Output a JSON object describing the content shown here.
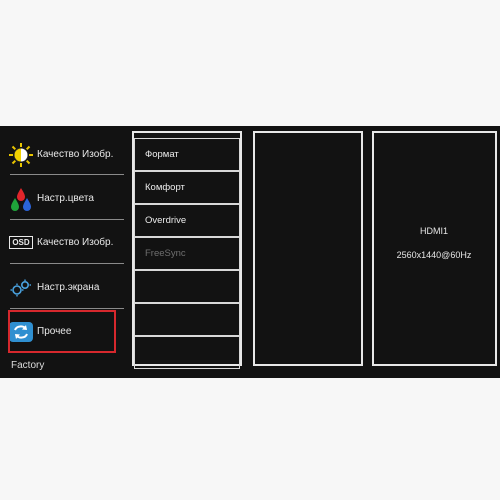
{
  "sidebar": {
    "items": [
      {
        "label": "Качество Изобр.",
        "icon": "brightness-icon"
      },
      {
        "label": "Настр.цвета",
        "icon": "color-drops-icon"
      },
      {
        "label": "Качество Изобр.",
        "icon": "osd-icon"
      },
      {
        "label": "Настр.экрана",
        "icon": "screen-settings-icon"
      },
      {
        "label": "Прочее",
        "icon": "refresh-icon",
        "selected": true
      }
    ],
    "footer": "Factory",
    "osd_badge": "OSD"
  },
  "submenu": {
    "items": [
      {
        "label": "Формат",
        "enabled": true
      },
      {
        "label": "Комфорт",
        "enabled": true
      },
      {
        "label": "Overdrive",
        "enabled": true
      },
      {
        "label": "FreeSync",
        "enabled": false
      },
      {
        "label": "",
        "enabled": true
      },
      {
        "label": "",
        "enabled": true
      },
      {
        "label": "",
        "enabled": true
      }
    ]
  },
  "info": {
    "input_source": "HDMI1",
    "resolution": "2560x1440@60Hz"
  },
  "colors": {
    "selection": "#d6282d",
    "background": "#121212",
    "border": "#e8e8e8",
    "disabled_text": "#6f6f6f"
  }
}
